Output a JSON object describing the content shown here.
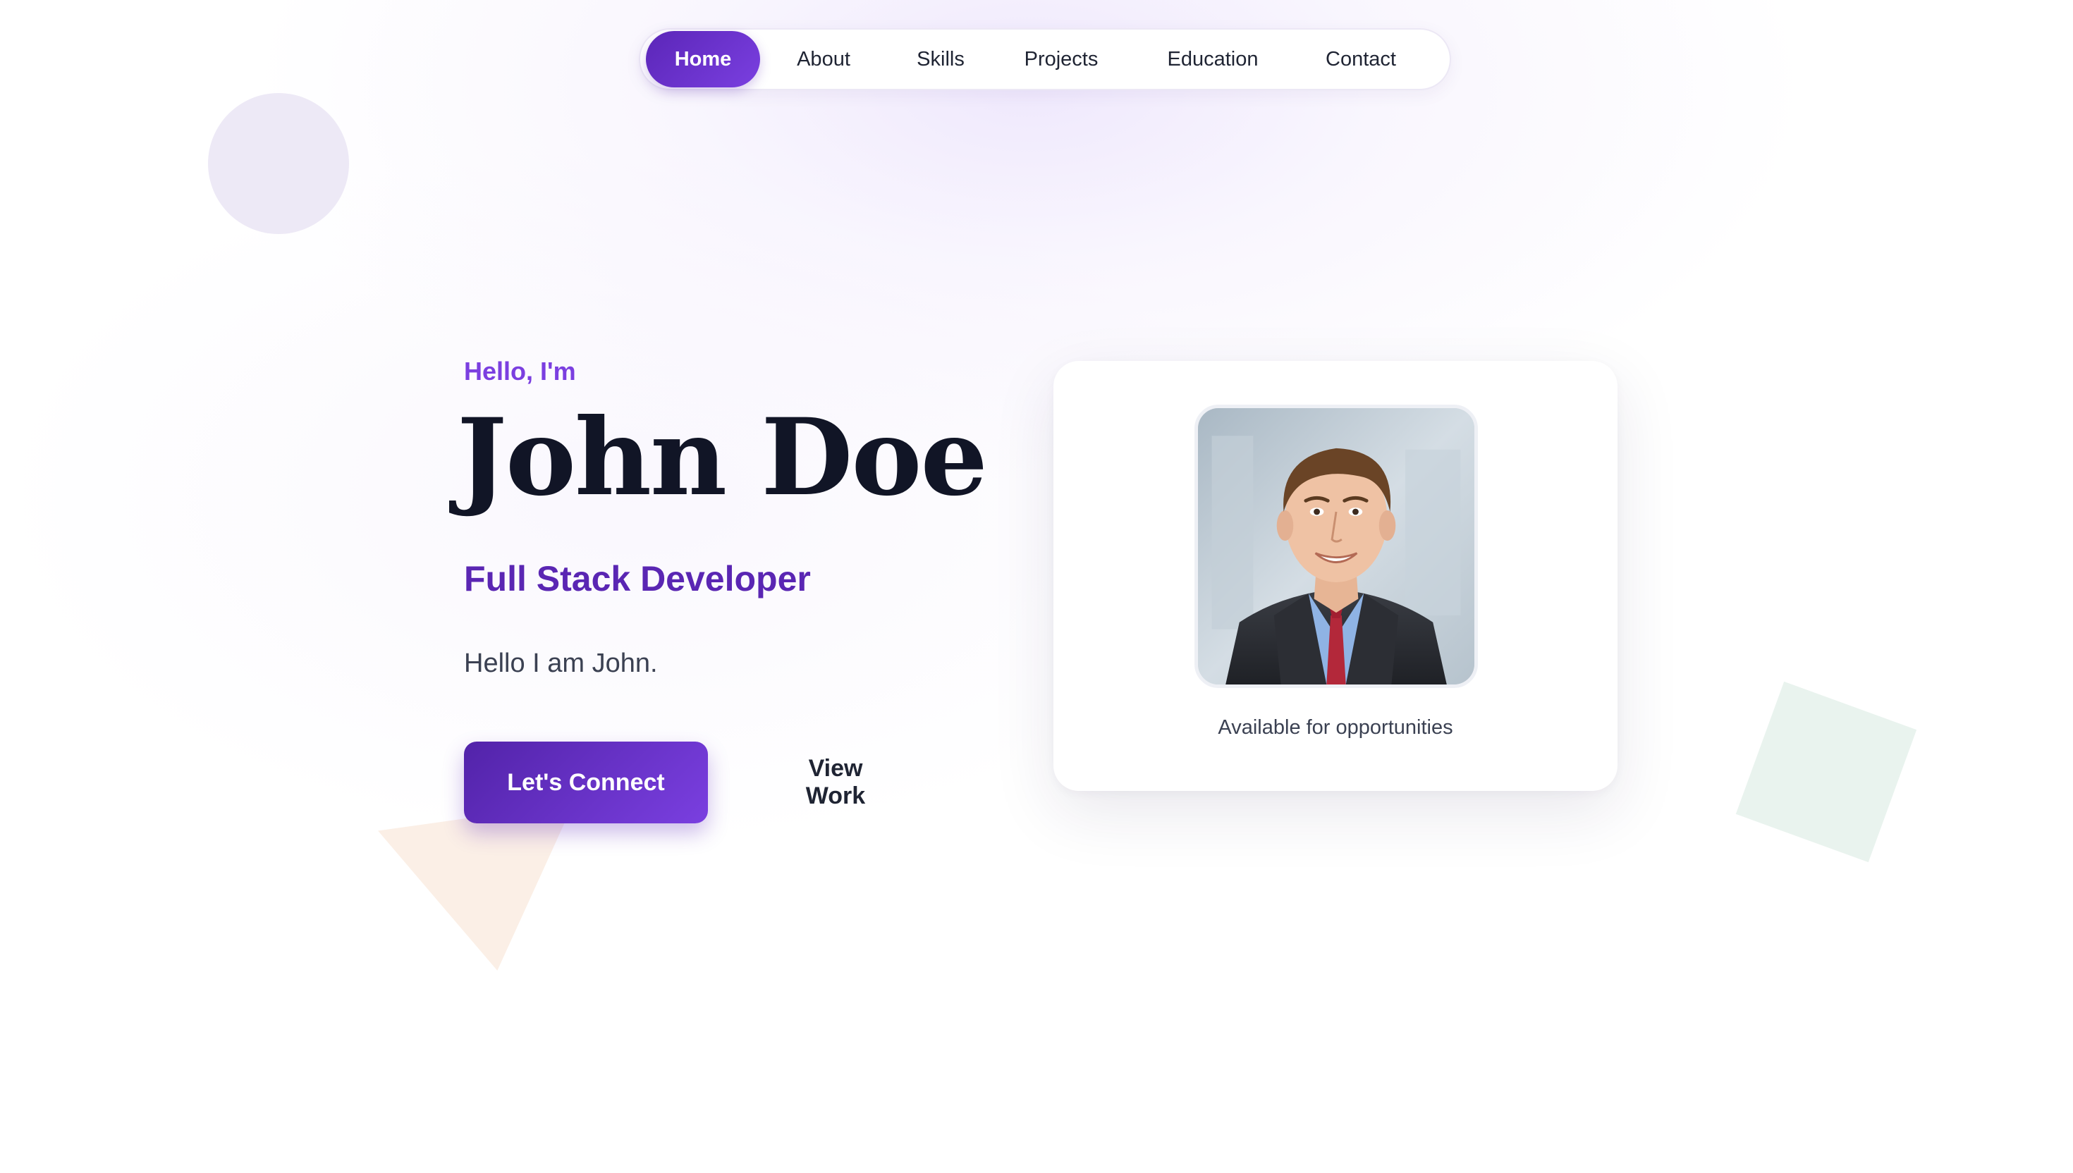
{
  "nav": {
    "items": [
      {
        "label": "Home",
        "active": true
      },
      {
        "label": "About",
        "active": false
      },
      {
        "label": "Skills",
        "active": false
      },
      {
        "label": "Projects",
        "active": false
      },
      {
        "label": "Education",
        "active": false
      },
      {
        "label": "Contact",
        "active": false
      }
    ]
  },
  "hero": {
    "greeting": "Hello, I'm",
    "name": "John Doe",
    "role": "Full Stack Developer",
    "intro": "Hello I am John.",
    "primary_button": "Let's Connect",
    "secondary_button": "View Work"
  },
  "profile_card": {
    "status": "Available for opportunities",
    "photo_description": "portrait-photo"
  },
  "colors": {
    "accent": "#7b3fe0",
    "accent_dark": "#5a26b3",
    "text_dark": "#111526",
    "deco_circle": "#ede9f6",
    "deco_triangle": "#fbefe6",
    "deco_square": "#e9f3ee"
  }
}
